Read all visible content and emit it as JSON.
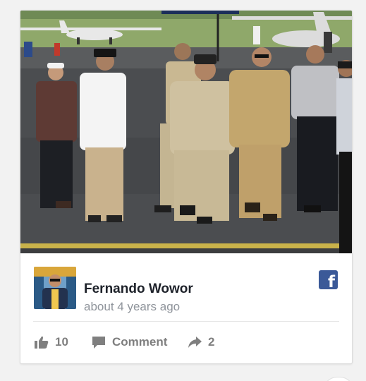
{
  "post": {
    "author_name": "Fernando Wowor",
    "timestamp": "about 4 years ago",
    "like_count": "10",
    "comment_label": "Comment",
    "share_count": "2"
  },
  "icons": {
    "source": "facebook-icon",
    "like": "thumbs-up-icon",
    "comment": "speech-bubble-icon",
    "share": "share-arrow-icon"
  },
  "colors": {
    "facebook_blue": "#3b5998",
    "author_text": "#1d2129",
    "muted_text": "#8f949b",
    "action_text": "#7f7f7f"
  }
}
